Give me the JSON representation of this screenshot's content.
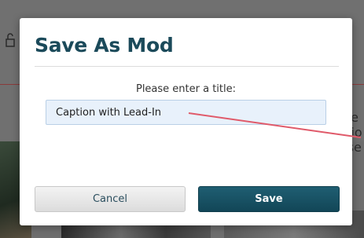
{
  "dialog": {
    "title": "Save As Mod",
    "prompt": "Please enter a title:",
    "title_input_value": "Caption with Lead-In",
    "cancel_label": "Cancel",
    "save_label": "Save"
  },
  "background": {
    "partial_text_lines": [
      "ote",
      "ptio",
      "Use"
    ]
  },
  "colors": {
    "title": "#1b4a5a",
    "save_button": "#124657",
    "input_background": "#e8f1fb",
    "annotation_arrow": "#e05a6a"
  },
  "icons": {
    "background_lock": "lock-icon"
  }
}
